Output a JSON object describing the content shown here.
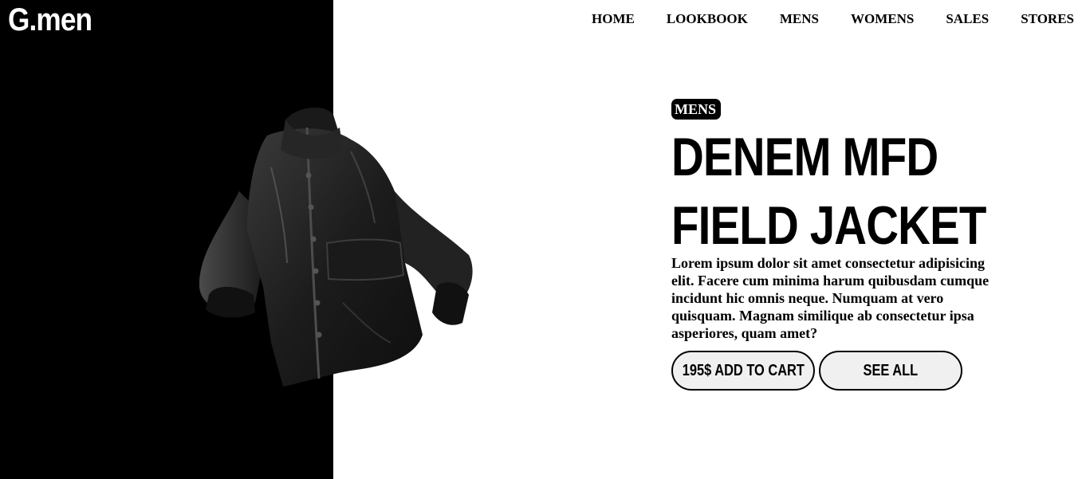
{
  "brand": {
    "logo": "G.men"
  },
  "nav": {
    "items": [
      "HOME",
      "LOOKBOOK",
      "MENS",
      "WOMENS",
      "SALES",
      "STORES"
    ]
  },
  "hero": {
    "category_tag": "MENS",
    "title_line1": "DENEM MFD",
    "title_line2": "FIELD JACKET",
    "description": "Lorem ipsum dolor sit amet consectetur adipisicing elit. Facere cum minima harum quibusdam cumque incidunt hic omnis neque. Numquam at vero quisquam. Magnam similique ab consectetur ipsa asperiores, quam amet?",
    "add_to_cart_label": "195$ ADD TO CART",
    "see_all_label": "SEE ALL",
    "product_image": "black-field-jacket"
  },
  "colors": {
    "left_panel": "#000000",
    "background": "#ffffff",
    "button_bg": "#f0f0f0"
  }
}
